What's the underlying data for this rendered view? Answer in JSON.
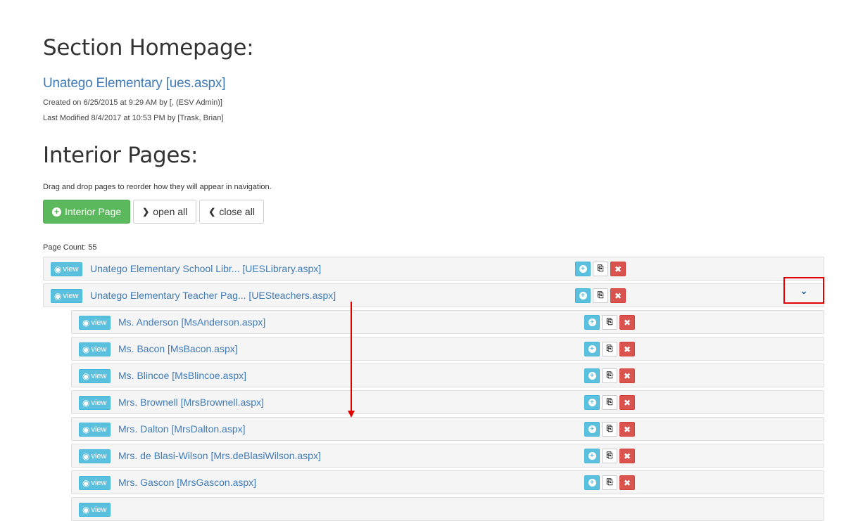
{
  "section": {
    "heading": "Section Homepage:",
    "homepage_link": "Unatego Elementary [ues.aspx]",
    "created": "Created on 6/25/2015 at 9:29 AM by [, (ESV Admin)]",
    "modified": "Last Modified 8/4/2017 at 10:53 PM by [Trask, Brian]"
  },
  "interior": {
    "heading": "Interior Pages:",
    "help": "Drag and drop pages to reorder how they will appear in navigation.",
    "buttons": {
      "add": "Interior Page",
      "open_all": "open all",
      "close_all": "close all"
    },
    "page_count": "Page Count: 55",
    "view_label": "view",
    "rows": [
      {
        "title": "Unatego Elementary School Libr... [UESLibrary.aspx]",
        "level": 1
      },
      {
        "title": "Unatego Elementary Teacher Pag... [UESteachers.aspx]",
        "level": 1
      },
      {
        "title": "Ms. Anderson [MsAnderson.aspx]",
        "level": 2
      },
      {
        "title": "Ms. Bacon [MsBacon.aspx]",
        "level": 2
      },
      {
        "title": "Ms. Blincoe [MsBlincoe.aspx]",
        "level": 2
      },
      {
        "title": "Mrs. Brownell [MrsBrownell.aspx]",
        "level": 2
      },
      {
        "title": "Mrs. Dalton [MrsDalton.aspx]",
        "level": 2
      },
      {
        "title": "Mrs. de Blasi-Wilson [Mrs.deBlasiWilson.aspx]",
        "level": 2
      },
      {
        "title": "Mrs. Gascon [MrsGascon.aspx]",
        "level": 2
      },
      {
        "title": "",
        "level": 2
      }
    ]
  },
  "icons": {
    "eye": "eye-icon",
    "add": "plus-circle-icon",
    "copy": "copy-icon",
    "delete": "remove-icon",
    "chevron": "chevron-down-icon"
  },
  "colors": {
    "link": "#3f7bb8",
    "success": "#5cb85c",
    "info": "#5bc0de",
    "danger": "#d9534f",
    "annotation": "#e00000"
  }
}
